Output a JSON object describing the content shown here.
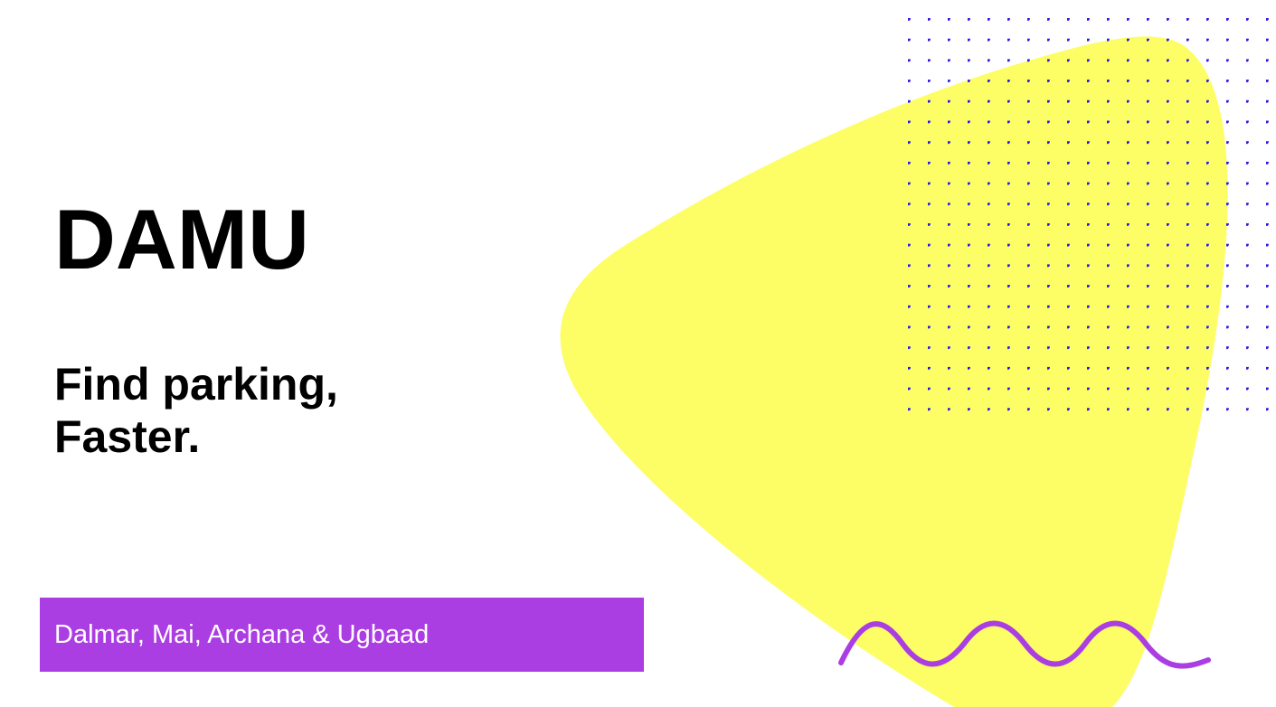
{
  "slide": {
    "title": "DAMU",
    "tagline_lines": [
      "Find parking,",
      "Faster."
    ],
    "authors": "Dalmar, Mai, Archana & Ugbaad"
  },
  "colors": {
    "background": "#ffffff",
    "text": "#000000",
    "accent_purple": "#ab3ee2",
    "blob_yellow": "#fdfe65",
    "dot_top": "#2a18e6",
    "dot_bottom": "#d8dca8",
    "authors_text": "#ffffff"
  },
  "icons": {
    "shape": "yellow-blob-shape",
    "dots": "dot-grid-pattern",
    "wave": "purple-wave-line"
  }
}
